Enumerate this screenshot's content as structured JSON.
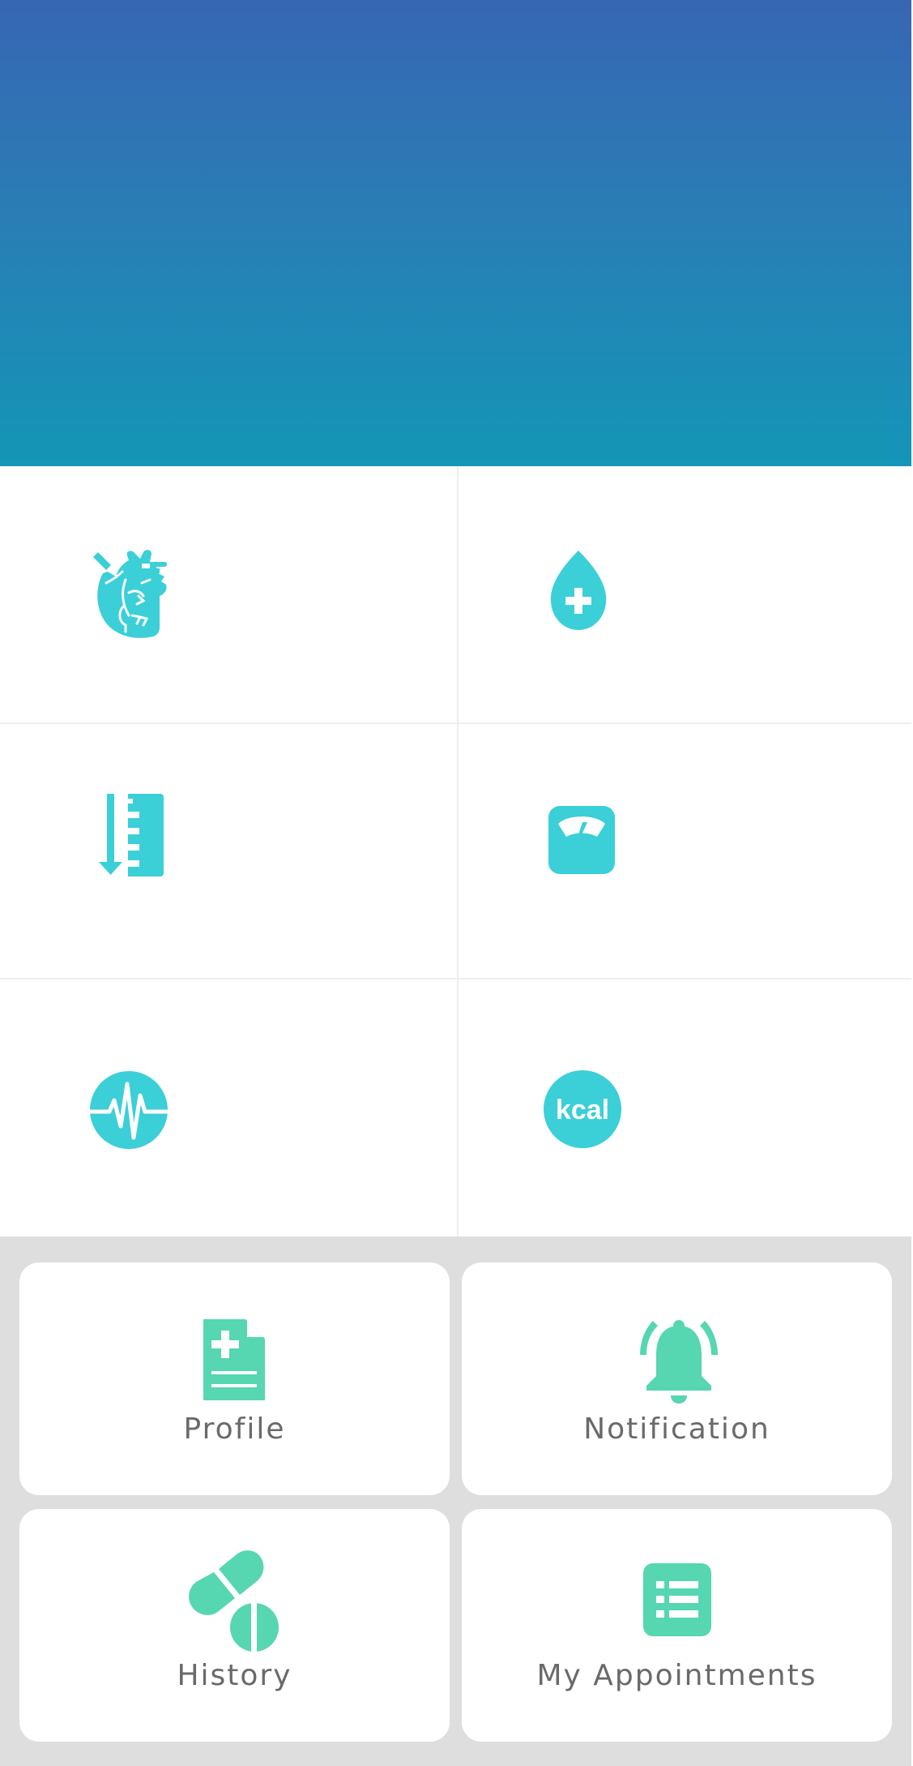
{
  "colors": {
    "header_gradient_top": "#3766b3",
    "header_gradient_bottom": "#1496b6",
    "metric_icon": "#3bcfd8",
    "menu_icon": "#56d6b1",
    "menu_background": "#dedede",
    "menu_label": "#6a6a6a"
  },
  "metrics": [
    {
      "name": "heart",
      "icon": "heart-anatomy-icon"
    },
    {
      "name": "blood",
      "icon": "blood-drop-cross-icon"
    },
    {
      "name": "height",
      "icon": "height-ruler-icon"
    },
    {
      "name": "weight",
      "icon": "weighing-scale-icon"
    },
    {
      "name": "pulse",
      "icon": "pulse-circle-icon"
    },
    {
      "name": "calories",
      "icon": "kcal-circle-icon",
      "icon_text": "kcal"
    }
  ],
  "menu": {
    "items": [
      {
        "label": "Profile",
        "icon": "medical-document-icon"
      },
      {
        "label": "Notification",
        "icon": "ringing-bell-icon"
      },
      {
        "label": "History",
        "icon": "pills-icon"
      },
      {
        "label": "My Appointments",
        "icon": "list-icon"
      }
    ]
  }
}
